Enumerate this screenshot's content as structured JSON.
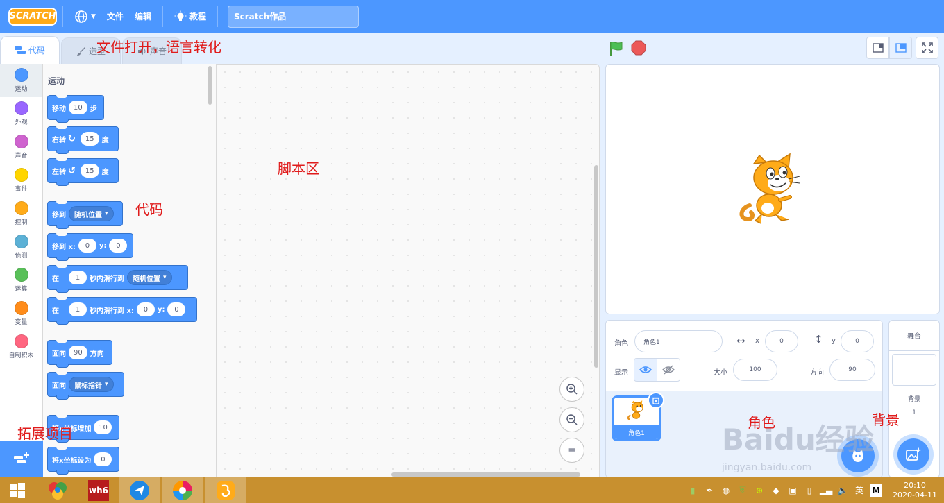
{
  "menubar": {
    "logo": "SCRATCH",
    "file": "文件",
    "edit": "编辑",
    "tutorial": "教程",
    "project_title": "Scratch作品"
  },
  "tabs": {
    "code": "代码",
    "costume": "造型",
    "sound": "声音"
  },
  "categories": [
    {
      "label": "运动",
      "color": "#4c97ff"
    },
    {
      "label": "外观",
      "color": "#9966ff"
    },
    {
      "label": "声音",
      "color": "#cf63cf"
    },
    {
      "label": "事件",
      "color": "#ffd500"
    },
    {
      "label": "控制",
      "color": "#ffab19"
    },
    {
      "label": "侦测",
      "color": "#5cb1d6"
    },
    {
      "label": "运算",
      "color": "#59c059"
    },
    {
      "label": "变量",
      "color": "#ff8c1a"
    },
    {
      "label": "自制积木",
      "color": "#ff6680"
    }
  ],
  "palette": {
    "section": "运动",
    "move": {
      "label": "移动",
      "steps": "10",
      "unit": "步"
    },
    "turn_right": {
      "label": "右转",
      "value": "15",
      "unit": "度"
    },
    "turn_left": {
      "label": "左转",
      "value": "15",
      "unit": "度"
    },
    "goto": {
      "label": "移到",
      "option": "随机位置"
    },
    "goto_xy": {
      "label": "移到 x:",
      "x": "0",
      "ylabel": "y:",
      "y": "0"
    },
    "glide": {
      "prefix": "在",
      "secs": "1",
      "mid": "秒内滑行到",
      "option": "随机位置"
    },
    "glide_xy": {
      "prefix": "在",
      "secs": "1",
      "mid": "秒内滑行到 x:",
      "x": "0",
      "ylabel": "y:",
      "y": "0"
    },
    "point": {
      "label": "面向",
      "value": "90",
      "unit": "方向"
    },
    "point_towards": {
      "label": "面向",
      "option": "鼠标指针"
    },
    "change_x": {
      "label": "将x坐标增加",
      "value": "10"
    },
    "set_x": {
      "label": "将x坐标设为",
      "value": "0"
    }
  },
  "sprite_info": {
    "sprite_label": "角色",
    "sprite_name": "角色1",
    "x_label": "x",
    "x": "0",
    "y_label": "y",
    "y": "0",
    "show_label": "显示",
    "size_label": "大小",
    "size": "100",
    "direction_label": "方向",
    "direction": "90"
  },
  "sprites": [
    {
      "name": "角色1"
    }
  ],
  "stage_selector": {
    "title": "舞台",
    "backdrop_label": "背景",
    "backdrop_count": "1"
  },
  "annotations": {
    "file_lang": "文件打开，语言转化",
    "code": "代码",
    "script_area": "脚本区",
    "extensions": "拓展项目",
    "sprite": "角色",
    "backdrop": "背景"
  },
  "watermark": {
    "brand": "Baidu经验",
    "url": "jingyan.baidu.com"
  },
  "taskbar": {
    "ime": "英",
    "time": "20:10",
    "date": "2020-04-11"
  }
}
